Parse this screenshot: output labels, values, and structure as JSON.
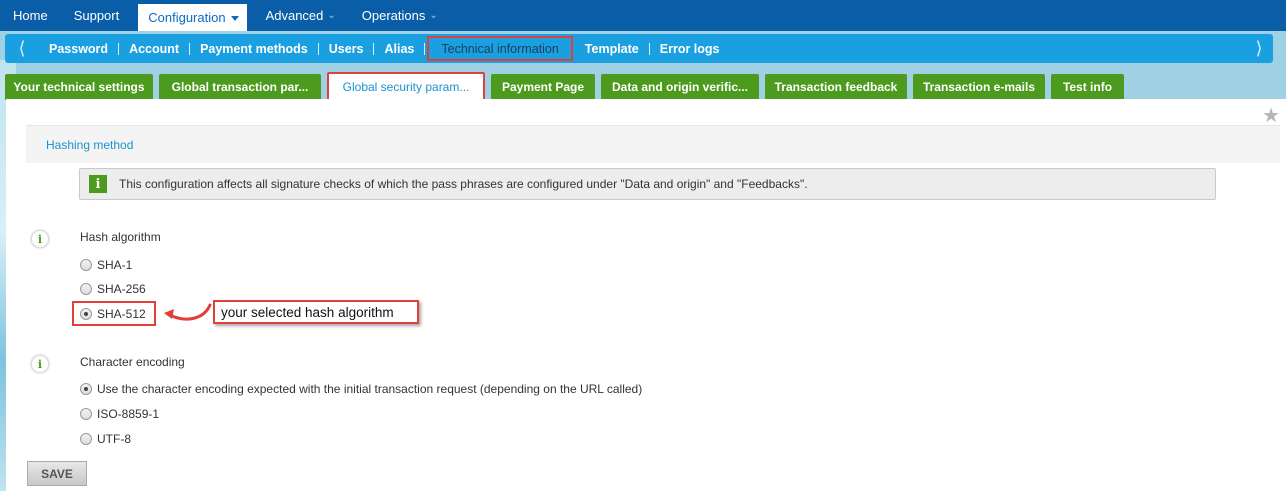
{
  "topnav": {
    "items": [
      {
        "label": "Home"
      },
      {
        "label": "Support"
      },
      {
        "label": "Configuration"
      },
      {
        "label": "Advanced"
      },
      {
        "label": "Operations"
      }
    ]
  },
  "subnav": {
    "items": [
      {
        "label": "Password"
      },
      {
        "label": "Account"
      },
      {
        "label": "Payment methods"
      },
      {
        "label": "Users"
      },
      {
        "label": "Alias"
      },
      {
        "label": "Technical information"
      },
      {
        "label": "Template"
      },
      {
        "label": "Error logs"
      }
    ]
  },
  "tabs": [
    {
      "label": "Your technical settings"
    },
    {
      "label": "Global transaction par..."
    },
    {
      "label": "Global security param..."
    },
    {
      "label": "Payment Page"
    },
    {
      "label": "Data and origin verific..."
    },
    {
      "label": "Transaction feedback"
    },
    {
      "label": "Transaction e-mails"
    },
    {
      "label": "Test info"
    }
  ],
  "section": {
    "title": "Hashing method",
    "info_text": "This configuration affects all signature checks of which the pass phrases are configured under \"Data and origin\" and \"Feedbacks\"."
  },
  "hash": {
    "label": "Hash algorithm",
    "options": [
      "SHA-1",
      "SHA-256",
      "SHA-512"
    ],
    "selected": "SHA-512",
    "callout": "your selected hash algorithm"
  },
  "encoding": {
    "label": "Character encoding",
    "options": [
      "Use the character encoding expected with the initial transaction request (depending on the URL called)",
      "ISO-8859-1",
      "UTF-8"
    ],
    "selected": "Use the character encoding expected with the initial transaction request (depending on the URL called)"
  },
  "save_label": "SAVE",
  "colors": {
    "topnav": "#0a5ea8",
    "subnav": "#1aa0e0",
    "tab_green": "#4c9a1e",
    "highlight_red": "#e0403a",
    "link_blue": "#1a93d2"
  }
}
